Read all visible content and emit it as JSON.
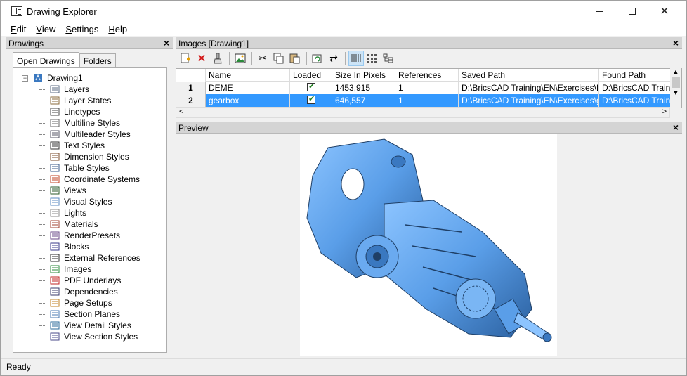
{
  "window": {
    "title": "Drawing Explorer"
  },
  "menu": [
    {
      "label": "Edit",
      "accel": "E",
      "rest": "dit"
    },
    {
      "label": "View",
      "accel": "V",
      "rest": "iew"
    },
    {
      "label": "Settings",
      "accel": "S",
      "rest": "ettings"
    },
    {
      "label": "Help",
      "accel": "H",
      "rest": "elp"
    }
  ],
  "drawings_panel": {
    "title": "Drawings",
    "tabs": [
      "Open Drawings",
      "Folders"
    ],
    "root": "Drawing1",
    "items": [
      {
        "label": "Layers",
        "icon": "layers-icon"
      },
      {
        "label": "Layer States",
        "icon": "layer-states-icon"
      },
      {
        "label": "Linetypes",
        "icon": "linetypes-icon"
      },
      {
        "label": "Multiline Styles",
        "icon": "multiline-styles-icon"
      },
      {
        "label": "Multileader Styles",
        "icon": "multileader-styles-icon"
      },
      {
        "label": "Text Styles",
        "icon": "text-styles-icon"
      },
      {
        "label": "Dimension Styles",
        "icon": "dimension-styles-icon"
      },
      {
        "label": "Table Styles",
        "icon": "table-styles-icon"
      },
      {
        "label": "Coordinate Systems",
        "icon": "coordinate-systems-icon"
      },
      {
        "label": "Views",
        "icon": "eye-icon"
      },
      {
        "label": "Visual Styles",
        "icon": "visual-styles-icon"
      },
      {
        "label": "Lights",
        "icon": "light-icon"
      },
      {
        "label": "Materials",
        "icon": "materials-icon"
      },
      {
        "label": "RenderPresets",
        "icon": "render-presets-icon"
      },
      {
        "label": "Blocks",
        "icon": "blocks-icon"
      },
      {
        "label": "External References",
        "icon": "external-references-icon"
      },
      {
        "label": "Images",
        "icon": "images-icon"
      },
      {
        "label": "PDF Underlays",
        "icon": "pdf-icon"
      },
      {
        "label": "Dependencies",
        "icon": "dependencies-icon"
      },
      {
        "label": "Page Setups",
        "icon": "page-setups-icon"
      },
      {
        "label": "Section Planes",
        "icon": "section-planes-icon"
      },
      {
        "label": "View Detail Styles",
        "icon": "view-detail-styles-icon"
      },
      {
        "label": "View Section Styles",
        "icon": "view-section-styles-icon"
      }
    ]
  },
  "images_panel": {
    "title": "Images [Drawing1]",
    "columns": [
      "Name",
      "Loaded",
      "Size In Pixels",
      "References",
      "Saved Path",
      "Found Path"
    ],
    "rows": [
      {
        "num": "1",
        "name": "DEME",
        "loaded": true,
        "size": "1453,915",
        "refs": "1",
        "saved": "D:\\BricsCAD Training\\EN\\Exercises\\DEME",
        "found": "D:\\BricsCAD Training"
      },
      {
        "num": "2",
        "name": "gearbox",
        "loaded": true,
        "size": "646,557",
        "refs": "1",
        "saved": "D:\\BricsCAD Training\\EN\\Exercises\\gearb",
        "found": "D:\\BricsCAD Training"
      }
    ],
    "selected_row": 2
  },
  "preview_panel": {
    "title": "Preview"
  },
  "status": {
    "text": "Ready"
  },
  "colors": {
    "selection": "#3399ff",
    "model": "#5a9ee8"
  }
}
